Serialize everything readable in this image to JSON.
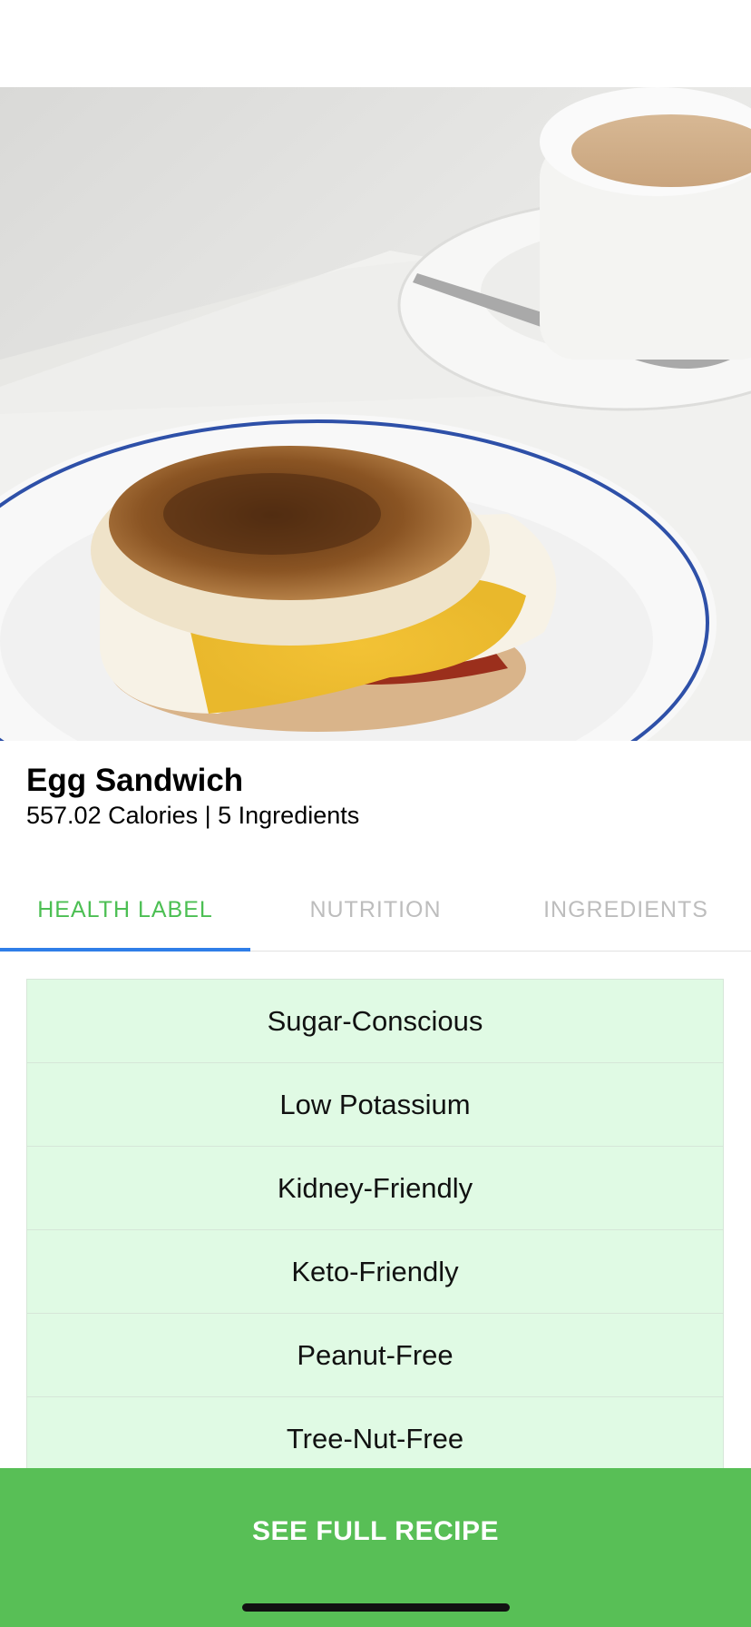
{
  "recipe": {
    "title": "Egg Sandwich",
    "summary": "557.02 Calories | 5 Ingredients",
    "image_alt": "egg-sandwich-photo"
  },
  "tabs": [
    {
      "label": "HEALTH LABEL",
      "active": true
    },
    {
      "label": "NUTRITION",
      "active": false
    },
    {
      "label": "INGREDIENTS",
      "active": false
    }
  ],
  "health_labels": [
    "Sugar-Conscious",
    "Low Potassium",
    "Kidney-Friendly",
    "Keto-Friendly",
    "Peanut-Free",
    "Tree-Nut-Free",
    ""
  ],
  "cta": {
    "label": "SEE FULL RECIPE"
  },
  "colors": {
    "accent_green": "#58bf56",
    "active_tab_text": "#4cbf53",
    "tab_indicator": "#2f7ee8",
    "list_background": "#e0fae4",
    "inactive_tab_text": "#bdbdbd"
  }
}
